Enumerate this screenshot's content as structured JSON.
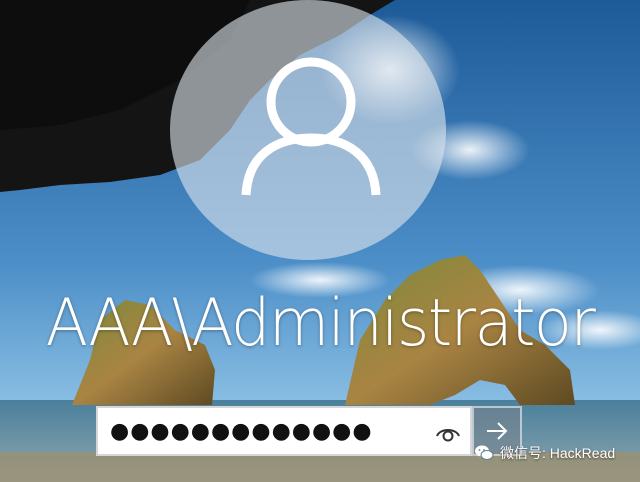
{
  "login": {
    "username": "AAA\\Administrator",
    "password_mask": "●●●●●●●●●●●●●"
  },
  "icons": {
    "avatar": "user-avatar-icon",
    "reveal": "eye-icon",
    "submit": "arrow-right-icon",
    "watermark": "wechat-icon"
  },
  "watermark": {
    "text": "微信号: HackRead"
  },
  "colors": {
    "sky_top": "#1f5f9e",
    "sky_bottom": "#7db6e0",
    "sea": "#5f8fa6",
    "rock": "#9a7a3c",
    "cave": "#141414"
  }
}
